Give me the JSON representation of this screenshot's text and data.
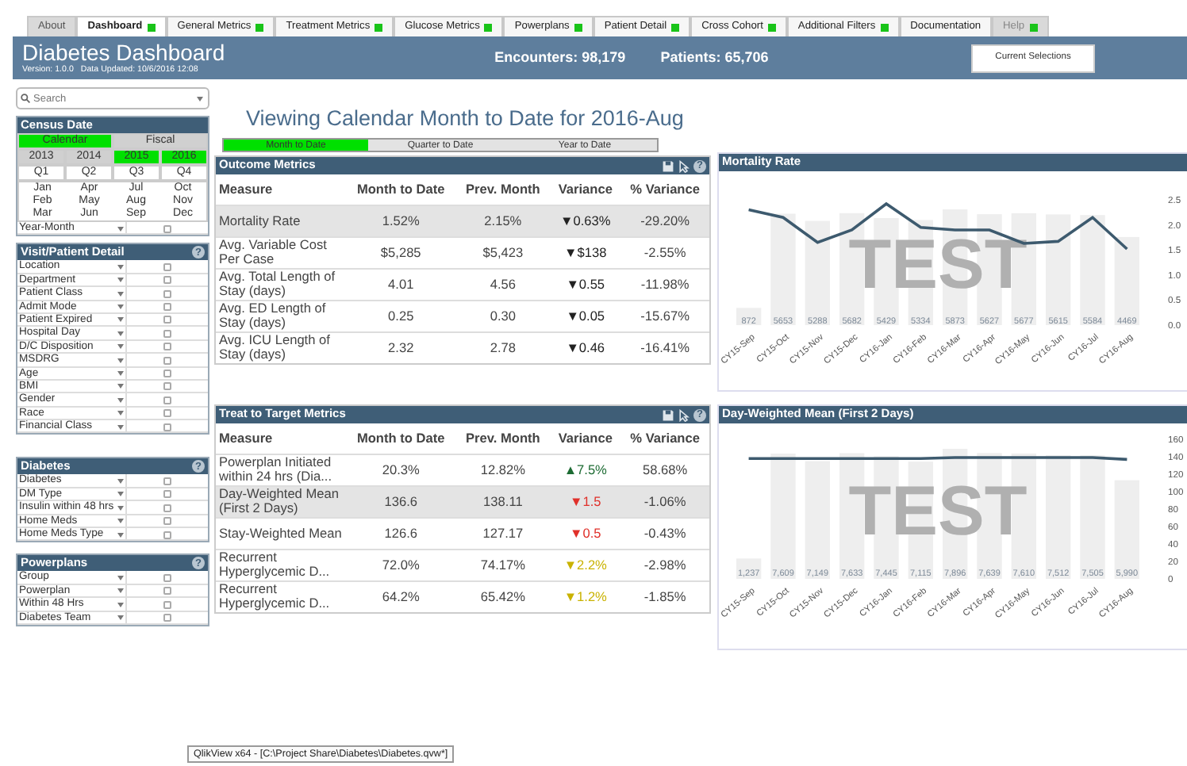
{
  "tabs": [
    {
      "label": "About",
      "selected": false,
      "dot": false,
      "dimmed": true
    },
    {
      "label": "Dashboard",
      "selected": true,
      "dot": true,
      "dimmed": false
    },
    {
      "label": "General Metrics",
      "selected": false,
      "dot": true,
      "dimmed": false
    },
    {
      "label": "Treatment Metrics",
      "selected": false,
      "dot": true,
      "dimmed": false
    },
    {
      "label": "Glucose Metrics",
      "selected": false,
      "dot": true,
      "dimmed": false
    },
    {
      "label": "Powerplans",
      "selected": false,
      "dot": true,
      "dimmed": false
    },
    {
      "label": "Patient Detail",
      "selected": false,
      "dot": true,
      "dimmed": false
    },
    {
      "label": "Cross Cohort",
      "selected": false,
      "dot": true,
      "dimmed": false
    },
    {
      "label": "Additional Filters",
      "selected": false,
      "dot": true,
      "dimmed": false
    },
    {
      "label": "Documentation",
      "selected": false,
      "dot": false,
      "dimmed": false
    },
    {
      "label": "Help",
      "selected": false,
      "dot": true,
      "dimmed": true
    }
  ],
  "header": {
    "title": "Diabetes Dashboard",
    "version": "Version: 1.0.0",
    "updated": "Data Updated:  10/6/2016 12:08",
    "stats": [
      "Encounters:  98,179",
      "Patients:  65,706"
    ],
    "button": "Current Selections"
  },
  "search": {
    "placeholder": "Search"
  },
  "census": {
    "title": "Census Date",
    "calendars": [
      {
        "label": "Calendar",
        "selected": true
      },
      {
        "label": "Fiscal",
        "selected": false
      }
    ],
    "years": [
      {
        "label": "2013",
        "selected": false
      },
      {
        "label": "2014",
        "selected": false
      },
      {
        "label": "2015",
        "selected": true
      },
      {
        "label": "2016",
        "selected": true
      }
    ],
    "quarters": [
      "Q1",
      "Q2",
      "Q3",
      "Q4"
    ],
    "months": [
      "Jan",
      "Apr",
      "Jul",
      "Oct",
      "Feb",
      "May",
      "Aug",
      "Nov",
      "Mar",
      "Jun",
      "Sep",
      "Dec"
    ],
    "filters": [
      {
        "label": "Year-Month",
        "checked": false
      }
    ]
  },
  "filter_panels": [
    {
      "title": "Visit/Patient Detail",
      "help": "?",
      "items": [
        {
          "label": "Location",
          "checked": false
        },
        {
          "label": "Department",
          "checked": false
        },
        {
          "label": "Patient Class",
          "checked": false
        },
        {
          "label": "Admit Mode",
          "checked": false
        },
        {
          "label": "Patient Expired",
          "checked": false
        },
        {
          "label": "Hospital Day",
          "checked": false
        },
        {
          "label": "D/C Disposition",
          "checked": false
        },
        {
          "label": "MSDRG",
          "checked": false
        },
        {
          "label": "Age",
          "checked": false
        },
        {
          "label": "BMI",
          "checked": false
        },
        {
          "label": "Gender",
          "checked": false
        },
        {
          "label": "Race",
          "checked": false
        },
        {
          "label": "Financial Class",
          "checked": false
        }
      ]
    },
    {
      "title": "Diabetes",
      "help": "?",
      "items": [
        {
          "label": "Diabetes",
          "checked": false
        },
        {
          "label": "DM Type",
          "checked": false
        },
        {
          "label": "Insulin within 48 hrs",
          "checked": false
        },
        {
          "label": "Home Meds",
          "checked": false
        },
        {
          "label": "Home Meds Type",
          "checked": false
        }
      ]
    },
    {
      "title": "Powerplans",
      "help": "?",
      "items": [
        {
          "label": "Group",
          "checked": false
        },
        {
          "label": "Powerplan",
          "checked": false
        },
        {
          "label": "Within 48 Hrs",
          "checked": false
        },
        {
          "label": "Diabetes Team",
          "checked": false
        }
      ]
    }
  ],
  "view_title": "Viewing Calendar Month to Date for 2016-Aug",
  "periods": [
    {
      "label": "Month to Date",
      "selected": true
    },
    {
      "label": "Quarter to Date",
      "selected": false
    },
    {
      "label": "Year to Date",
      "selected": false
    }
  ],
  "tables": [
    {
      "title": "Outcome Metrics",
      "help": "?",
      "columns": [
        "Measure",
        "Month to Date",
        "Prev. Month",
        "Variance",
        "% Variance"
      ],
      "rows": [
        {
          "cells": [
            "Mortality Rate",
            "1.52%",
            "2.15%",
            "▼0.63%",
            "-29.20%"
          ],
          "highlighted": true,
          "color": "#222222"
        },
        {
          "cells": [
            "Avg. Variable Cost Per Case",
            "$5,285",
            "$5,423",
            "▼$138",
            "-2.55%"
          ],
          "highlighted": false,
          "color": "#222222"
        },
        {
          "cells": [
            "Avg. Total Length of Stay (days)",
            "4.01",
            "4.56",
            "▼0.55",
            "-11.98%"
          ],
          "highlighted": false,
          "color": "#222222"
        },
        {
          "cells": [
            "Avg. ED Length of Stay (days)",
            "0.25",
            "0.30",
            "▼0.05",
            "-15.67%"
          ],
          "highlighted": false,
          "color": "#222222"
        },
        {
          "cells": [
            "Avg. ICU Length of Stay (days)",
            "2.32",
            "2.78",
            "▼0.46",
            "-16.41%"
          ],
          "highlighted": false,
          "color": "#222222"
        }
      ]
    },
    {
      "title": "Treat to Target Metrics",
      "help": "?",
      "columns": [
        "Measure",
        "Month to Date",
        "Prev. Month",
        "Variance",
        "% Variance"
      ],
      "rows": [
        {
          "cells": [
            "Powerplan Initiated within 24 hrs (Dia...",
            "20.3%",
            "12.82%",
            "▲7.5%",
            "58.68%"
          ],
          "highlighted": false,
          "color": "#1d6b33"
        },
        {
          "cells": [
            "Day-Weighted Mean (First 2 Days)",
            "136.6",
            "138.11",
            "▼1.5",
            "-1.06%"
          ],
          "highlighted": true,
          "color": "#e0302a"
        },
        {
          "cells": [
            "Stay-Weighted Mean",
            "126.6",
            "127.17",
            "▼0.5",
            "-0.43%"
          ],
          "highlighted": false,
          "color": "#e0302a"
        },
        {
          "cells": [
            "Recurrent Hyperglycemic D...",
            "72.0%",
            "74.17%",
            "▼2.2%",
            "-2.98%"
          ],
          "highlighted": false,
          "color": "#c9b200"
        },
        {
          "cells": [
            "Recurrent Hyperglycemic D...",
            "64.2%",
            "65.42%",
            "▼1.2%",
            "-1.85%"
          ],
          "highlighted": false,
          "color": "#c9b200"
        }
      ]
    }
  ],
  "charts": [
    {
      "title": "Mortality Rate",
      "watermark": "TEST",
      "bar_labels": [
        "872",
        "5653",
        "5288",
        "5682",
        "5429",
        "5334",
        "5873",
        "5627",
        "5677",
        "5615",
        "5584",
        "4469"
      ],
      "chart_data": {
        "type": "line",
        "categories": [
          "CY15-Sep",
          "CY15-Oct",
          "CY15-Nov",
          "CY15-Dec",
          "CY16-Jan",
          "CY16-Feb",
          "CY16-Mar",
          "CY16-Apr",
          "CY16-May",
          "CY16-Jun",
          "CY16-Jul",
          "CY16-Aug"
        ],
        "series": [
          {
            "color": "#3d5a6e",
            "values": [
              2.3,
              2.15,
              1.65,
              1.9,
              2.42,
              1.95,
              1.9,
              1.9,
              1.63,
              1.67,
              2.15,
              1.52
            ]
          }
        ],
        "ylim": [
          0,
          2.5
        ],
        "yticks": [
          {
            "value": 2.5,
            "label": "2.5"
          },
          {
            "value": 2,
            "label": "2.0"
          },
          {
            "value": 1.5,
            "label": "1.5"
          },
          {
            "value": 1,
            "label": "1.0"
          },
          {
            "value": 0.5,
            "label": "0.5"
          },
          {
            "value": 0,
            "label": "0.0"
          }
        ]
      }
    },
    {
      "title": "Day-Weighted Mean (First 2 Days)",
      "watermark": "TEST",
      "bar_labels": [
        "1,237",
        "7,609",
        "7,149",
        "7,633",
        "7,445",
        "7,115",
        "7,896",
        "7,639",
        "7,610",
        "7,512",
        "7,505",
        "5,990"
      ],
      "chart_data": {
        "type": "line",
        "categories": [
          "CY15-Sep",
          "CY15-Oct",
          "CY15-Nov",
          "CY15-Dec",
          "CY16-Jan",
          "CY16-Feb",
          "CY16-Mar",
          "CY16-Apr",
          "CY16-May",
          "CY16-Jun",
          "CY16-Jul",
          "CY16-Aug"
        ],
        "series": [
          {
            "color": "#3d5a6e",
            "values": [
              138,
              138,
              138,
              138,
              138,
              138,
              139,
              139,
              139,
              139,
              139,
              137
            ]
          }
        ],
        "ylim": [
          0,
          160
        ],
        "yticks": [
          160,
          140,
          120,
          100,
          80,
          60,
          40,
          20,
          0
        ]
      }
    }
  ],
  "tooltip": "QlikView x64 - [C:\\Project Share\\Diabetes\\Diabetes.qvw*]"
}
